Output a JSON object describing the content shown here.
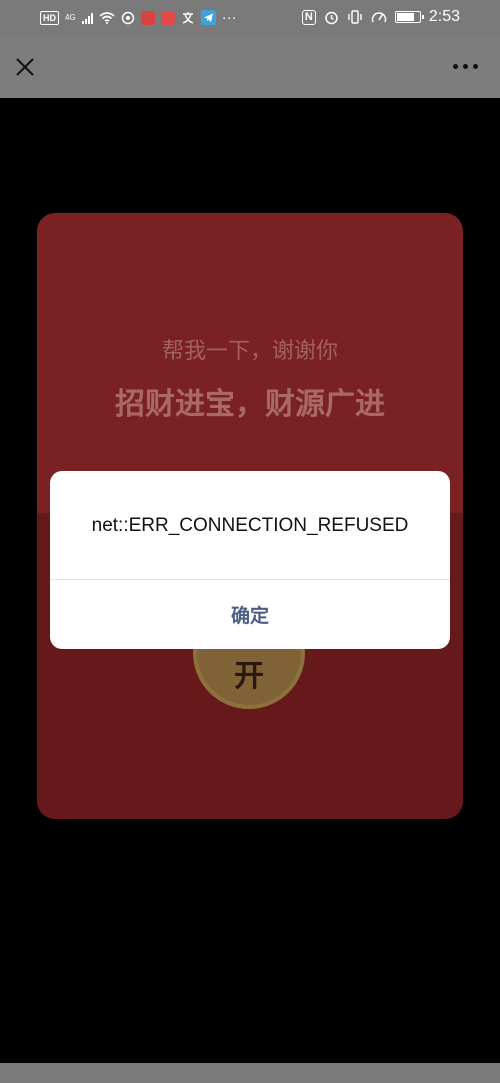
{
  "status_bar": {
    "hd_badge": "HD",
    "network": "4G",
    "dots": "···",
    "nfc": "N",
    "time": "2:53"
  },
  "nav": {
    "close_icon": "close-icon",
    "more_icon": "more-icon"
  },
  "envelope": {
    "line1": "帮我一下，谢谢你",
    "line2": "招财进宝，财源广进",
    "open_label": "开",
    "color": "#852428"
  },
  "dialog": {
    "message": "net::ERR_CONNECTION_REFUSED",
    "confirm_label": "确定",
    "confirm_color": "#4e5d83"
  }
}
